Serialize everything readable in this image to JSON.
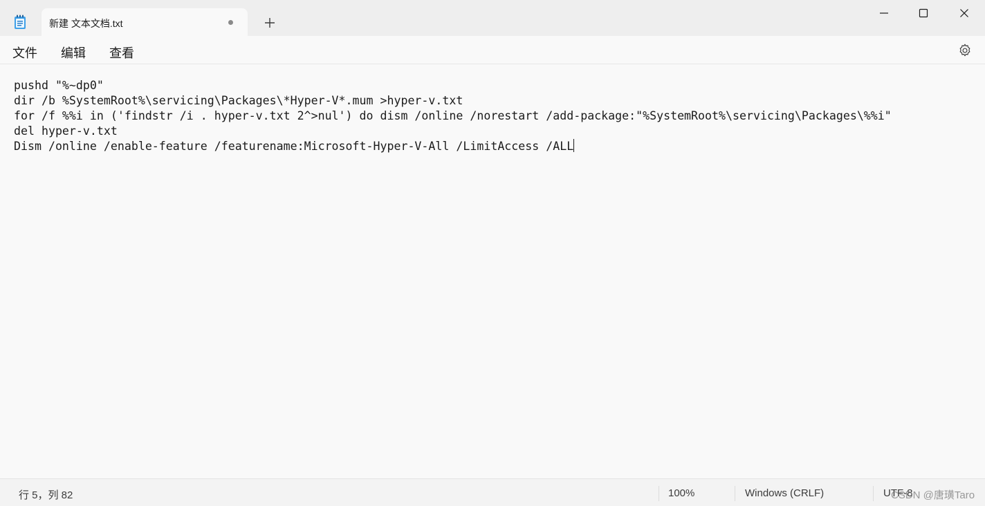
{
  "window": {
    "tab_title": "新建 文本文档.txt",
    "unsaved_indicator": "modified-dot-icon",
    "icons": {
      "app": "notepad-icon",
      "new_tab": "plus-icon",
      "minimize": "minimize-icon",
      "maximize": "maximize-icon",
      "close": "close-icon"
    }
  },
  "menu": {
    "file": "文件",
    "edit": "编辑",
    "view": "查看",
    "settings_icon": "gear-icon"
  },
  "editor": {
    "lines": [
      "pushd \"%~dp0\"",
      "dir /b %SystemRoot%\\servicing\\Packages\\*Hyper-V*.mum >hyper-v.txt",
      "for /f %%i in ('findstr /i . hyper-v.txt 2^>nul') do dism /online /norestart /add-package:\"%SystemRoot%\\servicing\\Packages\\%%i\"",
      "del hyper-v.txt",
      "Dism /online /enable-feature /featurename:Microsoft-Hyper-V-All /LimitAccess /ALL"
    ]
  },
  "status": {
    "position": "行 5，列 82",
    "zoom": "100%",
    "line_ending": "Windows (CRLF)",
    "encoding": "UTF-8"
  },
  "watermark": "CSDN @唐璜Taro",
  "colors": {
    "titlebar": "#eeeeee",
    "editor_bg": "#f9f9f9",
    "text": "#1b1b1b",
    "app_icon_accent": "#1f7fd6"
  }
}
